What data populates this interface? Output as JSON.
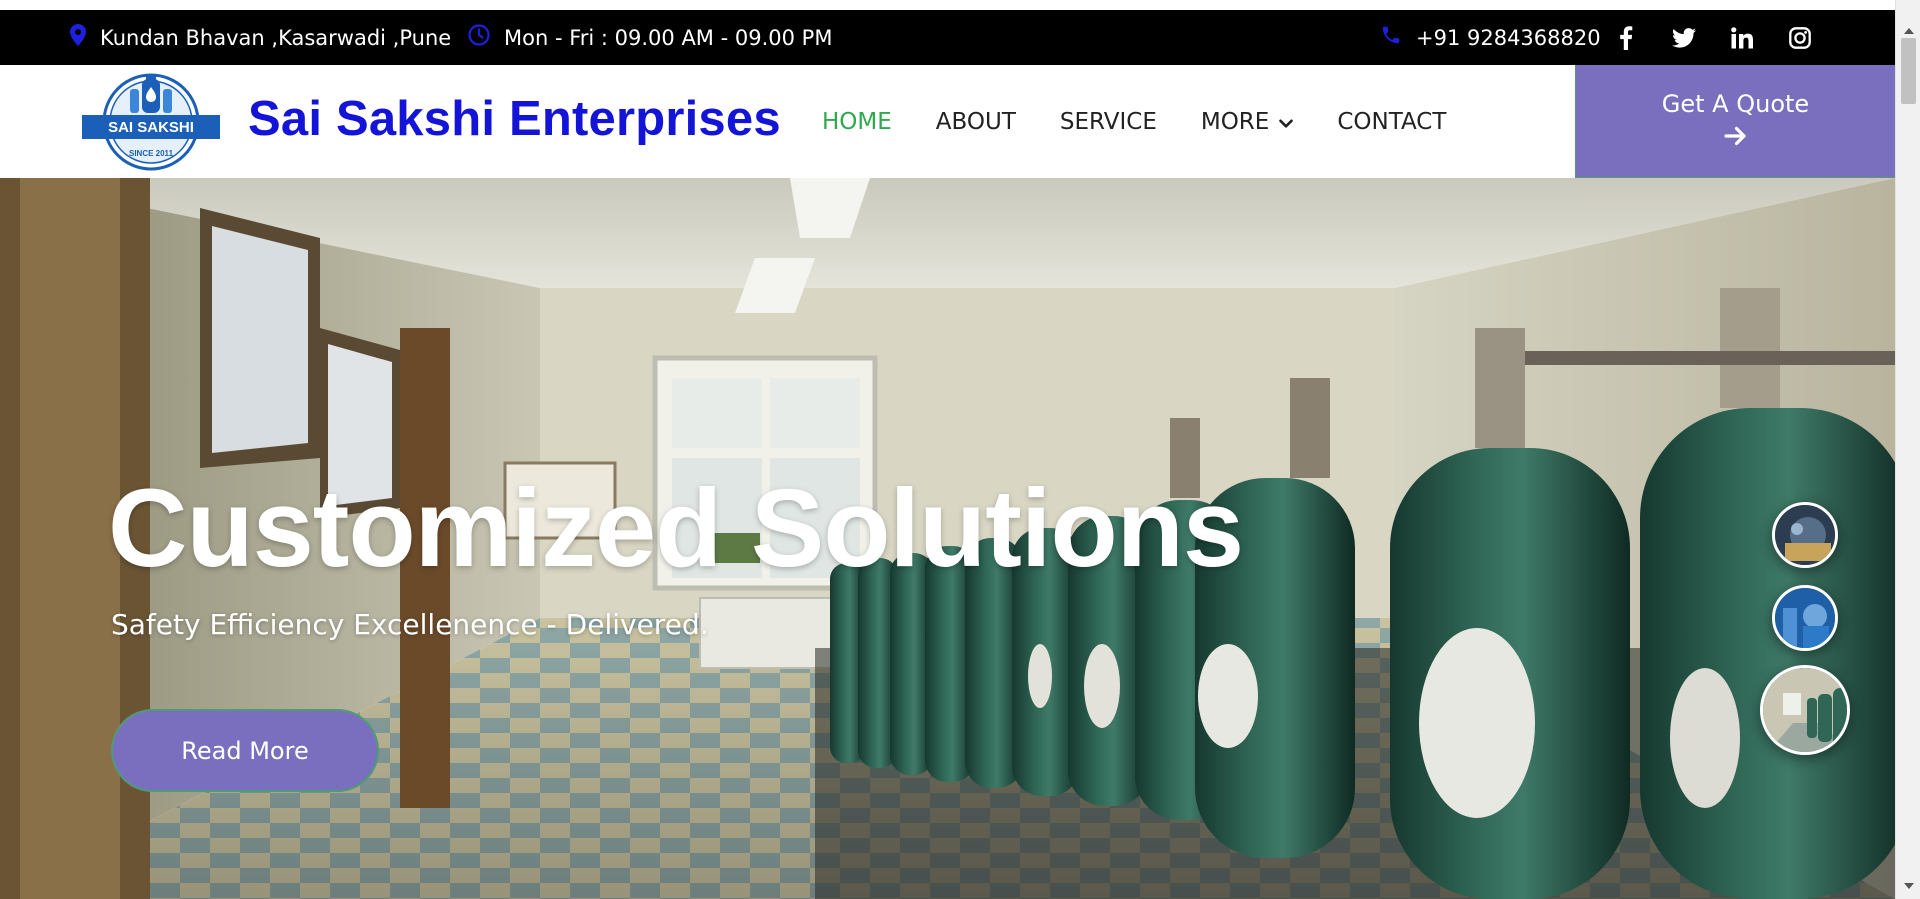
{
  "topbar": {
    "location": "Kundan Bhavan ,Kasarwadi ,Pune",
    "hours": "Mon - Fri : 09.00 AM - 09.00 PM",
    "phone": "+91 9284368820",
    "social": [
      "facebook-icon",
      "twitter-icon",
      "linkedin-icon",
      "instagram-icon"
    ]
  },
  "header": {
    "logo_text": "SAI SAKSHI",
    "logo_since": "SINCE 2011",
    "brand": "Sai Sakshi Enterprises",
    "nav": [
      {
        "label": "HOME",
        "active": true
      },
      {
        "label": "ABOUT"
      },
      {
        "label": "SERVICE"
      },
      {
        "label": "MORE",
        "dropdown": true
      },
      {
        "label": "CONTACT"
      }
    ],
    "quote_button": "Get A Quote"
  },
  "hero": {
    "title": "Customized Solutions",
    "subtitle": "Safety Efficiency Excellenence - Delivered.",
    "read_more": "Read More"
  },
  "colors": {
    "brand_blue": "#1414d8",
    "accent_purple": "#7a6fbf",
    "active_green": "#2fa84f",
    "topbar_bg": "#000000"
  }
}
